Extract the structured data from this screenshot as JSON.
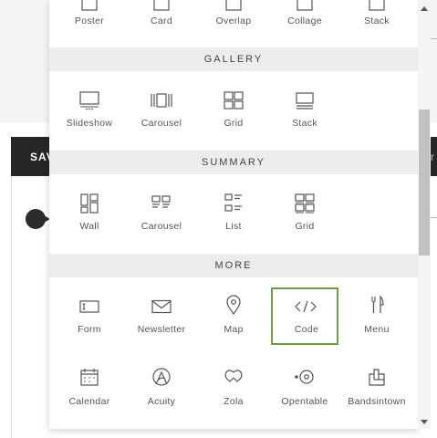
{
  "background": {
    "save_label": "SAV",
    "right_label": "r"
  },
  "colors": {
    "selected_border": "#6aa040",
    "section_bg": "#ececec",
    "icon": "#555555"
  },
  "top_row": [
    {
      "label": "Poster",
      "icon": "poster-icon"
    },
    {
      "label": "Card",
      "icon": "card-icon"
    },
    {
      "label": "Overlap",
      "icon": "overlap-icon"
    },
    {
      "label": "Collage",
      "icon": "collage-icon"
    },
    {
      "label": "Stack",
      "icon": "stack-icon"
    }
  ],
  "gallery": {
    "title": "GALLERY",
    "items": [
      {
        "label": "Slideshow",
        "icon": "slideshow-icon"
      },
      {
        "label": "Carousel",
        "icon": "carousel-icon"
      },
      {
        "label": "Grid",
        "icon": "grid-icon"
      },
      {
        "label": "Stack",
        "icon": "stack-icon"
      }
    ]
  },
  "summary": {
    "title": "SUMMARY",
    "items": [
      {
        "label": "Wall",
        "icon": "wall-icon"
      },
      {
        "label": "Carousel",
        "icon": "carousel-icon"
      },
      {
        "label": "List",
        "icon": "list-icon"
      },
      {
        "label": "Grid",
        "icon": "grid-icon"
      }
    ]
  },
  "more": {
    "title": "MORE",
    "items": [
      {
        "label": "Form",
        "icon": "form-icon"
      },
      {
        "label": "Newsletter",
        "icon": "envelope-icon"
      },
      {
        "label": "Map",
        "icon": "map-pin-icon"
      },
      {
        "label": "Code",
        "icon": "code-icon",
        "selected": true
      },
      {
        "label": "Menu",
        "icon": "fork-knife-icon"
      },
      {
        "label": "Calendar",
        "icon": "calendar-icon"
      },
      {
        "label": "Acuity",
        "icon": "acuity-icon"
      },
      {
        "label": "Zola",
        "icon": "zola-rings-icon"
      },
      {
        "label": "Opentable",
        "icon": "opentable-icon"
      },
      {
        "label": "Bandsintown",
        "icon": "bandsintown-icon"
      }
    ]
  }
}
